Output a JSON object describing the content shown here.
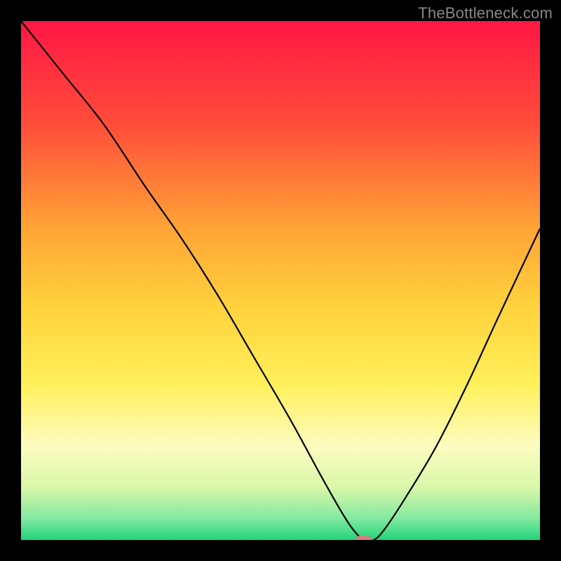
{
  "watermark": "TheBottleneck.com",
  "chart_data": {
    "type": "line",
    "title": "",
    "xlabel": "",
    "ylabel": "",
    "xlim": [
      0,
      100
    ],
    "ylim": [
      0,
      100
    ],
    "grid": false,
    "background_gradient": {
      "stops": [
        {
          "offset": 0,
          "color": "#ff1744"
        },
        {
          "offset": 20,
          "color": "#ff4d3a"
        },
        {
          "offset": 40,
          "color": "#ffa436"
        },
        {
          "offset": 55,
          "color": "#ffd23c"
        },
        {
          "offset": 70,
          "color": "#fff05a"
        },
        {
          "offset": 82,
          "color": "#fdfcc0"
        },
        {
          "offset": 90,
          "color": "#d8f7a8"
        },
        {
          "offset": 96,
          "color": "#7fe9a0"
        },
        {
          "offset": 100,
          "color": "#22d47a"
        }
      ]
    },
    "series": [
      {
        "name": "bottleneck-curve",
        "color": "#000000",
        "x": [
          0,
          8,
          16,
          24,
          31,
          38,
          45,
          52,
          58,
          62,
          64,
          66,
          68,
          70,
          74,
          80,
          86,
          92,
          100
        ],
        "y": [
          100,
          90,
          80,
          68,
          58,
          47,
          35,
          23,
          12,
          5,
          2,
          0,
          0,
          2,
          8,
          18,
          30,
          43,
          60
        ]
      }
    ],
    "marker": {
      "name": "optimal-point",
      "x": 66,
      "y": 0,
      "color": "#d08080",
      "width": 3.2,
      "height": 1.6
    }
  }
}
